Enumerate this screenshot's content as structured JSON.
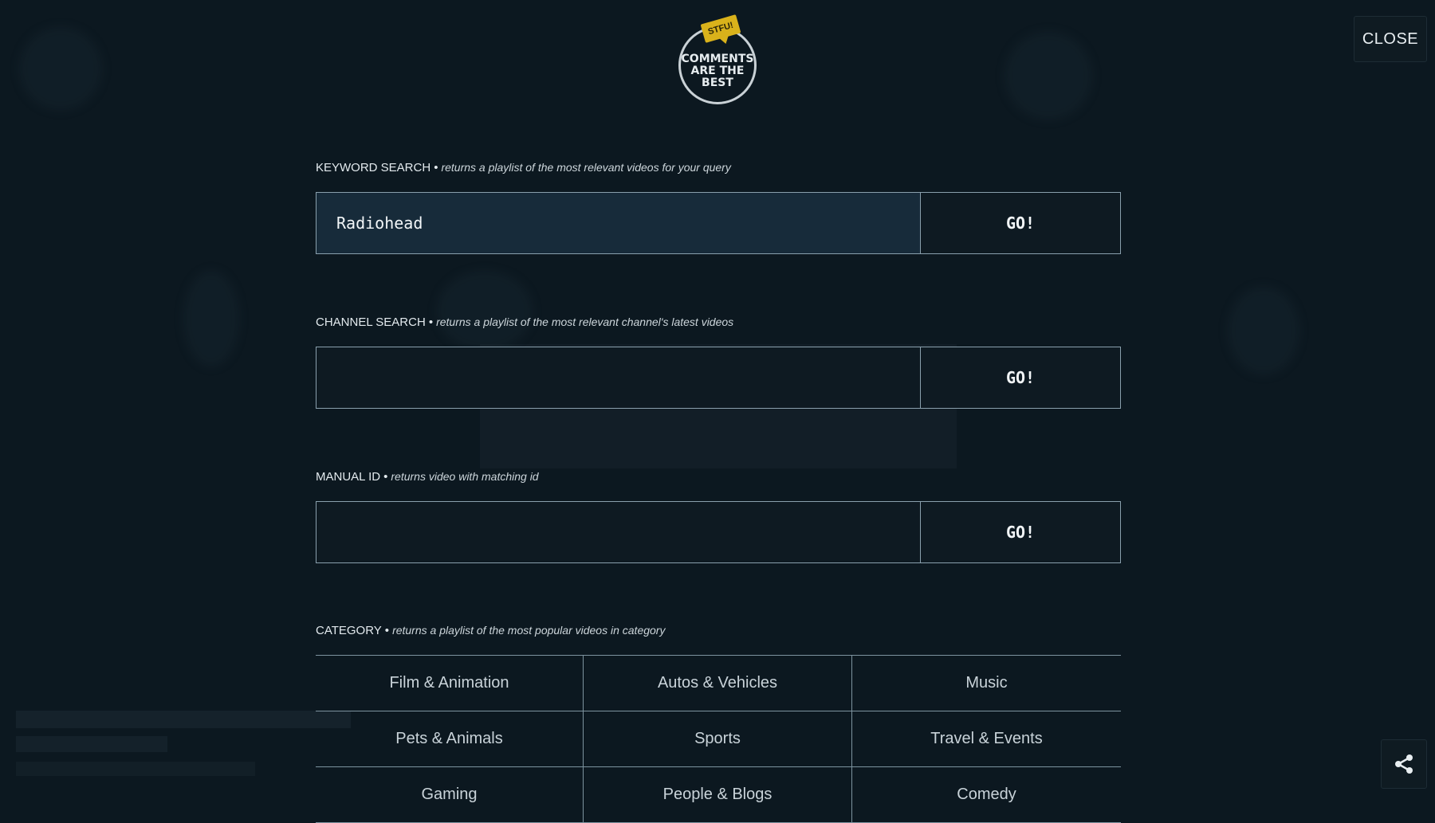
{
  "logo": {
    "tag": "STFU!",
    "text": "COMMENTS\nARE THE\nBEST"
  },
  "close_label": "CLOSE",
  "sections": {
    "keyword": {
      "title": "KEYWORD SEARCH",
      "separator": "•",
      "description": "returns a playlist of the most relevant videos for your query",
      "value": "Radiohead",
      "go_label": "GO!"
    },
    "channel": {
      "title": "CHANNEL SEARCH",
      "separator": "•",
      "description": "returns a playlist of the most relevant channel's latest videos",
      "value": "",
      "go_label": "GO!"
    },
    "manual": {
      "title": "MANUAL ID",
      "separator": "•",
      "description": "returns video with matching id",
      "value": "",
      "go_label": "GO!"
    },
    "category": {
      "title": "CATEGORY",
      "separator": "•",
      "description": "returns a playlist of the most popular videos in category",
      "items": [
        "Film & Animation",
        "Autos & Vehicles",
        "Music",
        "Pets & Animals",
        "Sports",
        "Travel & Events",
        "Gaming",
        "People & Blogs",
        "Comedy"
      ]
    }
  },
  "icons": {
    "share": "share-icon"
  },
  "colors": {
    "background": "#0c1820",
    "logo_tag": "#d9b21b",
    "input_filled": "#172b3a",
    "border": "#8aa0ad"
  }
}
